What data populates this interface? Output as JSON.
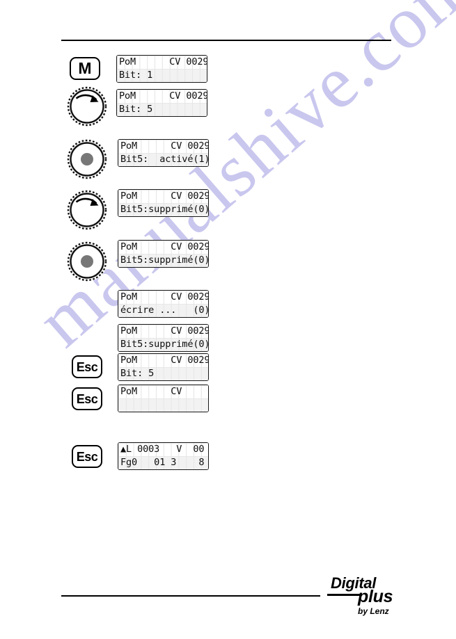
{
  "page": {
    "watermark_text": "manualshive.com",
    "watermark_color": "#c9c7ee",
    "rule_color": "#000000",
    "lcd_text_color": "#0d0d0d",
    "lcd_grid_color": "#e4e4e4"
  },
  "steps": [
    {
      "icon": "key-m",
      "icon_label": "M",
      "lcd": {
        "line1": "PoM      CV 0029",
        "line2": "Bit: 1"
      }
    },
    {
      "icon": "knob-rotate",
      "icon_label": "",
      "lcd": {
        "line1": "PoM      CV 0029",
        "line2": "Bit: 5"
      }
    },
    {
      "icon": "knob-press",
      "icon_label": "",
      "lcd": {
        "line1": "PoM      CV 0029",
        "line2": "Bit5:  activé(1)"
      }
    },
    {
      "icon": "knob-rotate",
      "icon_label": "",
      "lcd": {
        "line1": "PoM      CV 0029",
        "line2": "Bit5:supprimé(0)"
      }
    },
    {
      "icon": "knob-press",
      "icon_label": "",
      "lcd": {
        "line1": "PoM      CV 0029",
        "line2": "Bit5:supprimé(0)"
      }
    },
    {
      "icon": "none",
      "icon_label": "",
      "lcd": {
        "line1": "PoM      CV 0029",
        "line2": "écrire ...   (0)"
      }
    },
    {
      "icon": "none",
      "icon_label": "",
      "lcd": {
        "line1": "PoM      CV 0029",
        "line2": "Bit5:supprimé(0)"
      }
    },
    {
      "icon": "key-esc",
      "icon_label": "Esc",
      "lcd": {
        "line1": "PoM      CV 0029",
        "line2": "Bit: 5"
      }
    },
    {
      "icon": "key-esc",
      "icon_label": "Esc",
      "lcd": {
        "line1": "PoM      CV      _",
        "line2": ""
      }
    },
    {
      "icon": "key-esc",
      "icon_label": "Esc",
      "lcd": {
        "line1": "▲L 0003   V  00",
        "line2": "Fg0   01 3    8"
      }
    }
  ],
  "logo": {
    "word1": "Digital",
    "word2": "plus",
    "byline": "by Lenz"
  }
}
